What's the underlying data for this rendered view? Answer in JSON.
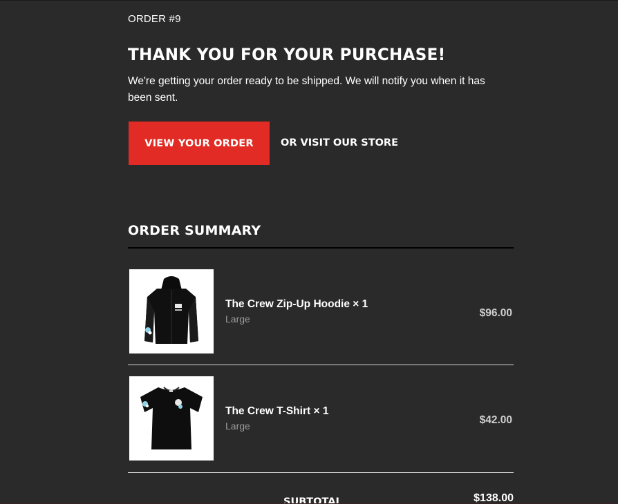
{
  "header": {
    "order_number": "ORDER #9"
  },
  "main": {
    "headline": "THANK YOU FOR YOUR PURCHASE!",
    "subtext": "We're getting your order ready to be shipped. We will notify you when it has been sent.",
    "view_order_label": "VIEW YOUR ORDER",
    "visit_store_label": "OR VISIT OUR STORE"
  },
  "summary": {
    "title": "ORDER SUMMARY",
    "items": [
      {
        "name": "The Crew Zip-Up Hoodie × 1",
        "variant": "Large",
        "price": "$96.00",
        "image_icon": "hoodie-image"
      },
      {
        "name": "The Crew T-Shirt × 1",
        "variant": "Large",
        "price": "$42.00",
        "image_icon": "tshirt-image"
      }
    ],
    "subtotal_label": "SUBTOTAL",
    "subtotal_value": "$138.00"
  },
  "colors": {
    "background": "#2a2a2a",
    "button": "#e22b24",
    "muted_text": "#9a9a9a"
  }
}
